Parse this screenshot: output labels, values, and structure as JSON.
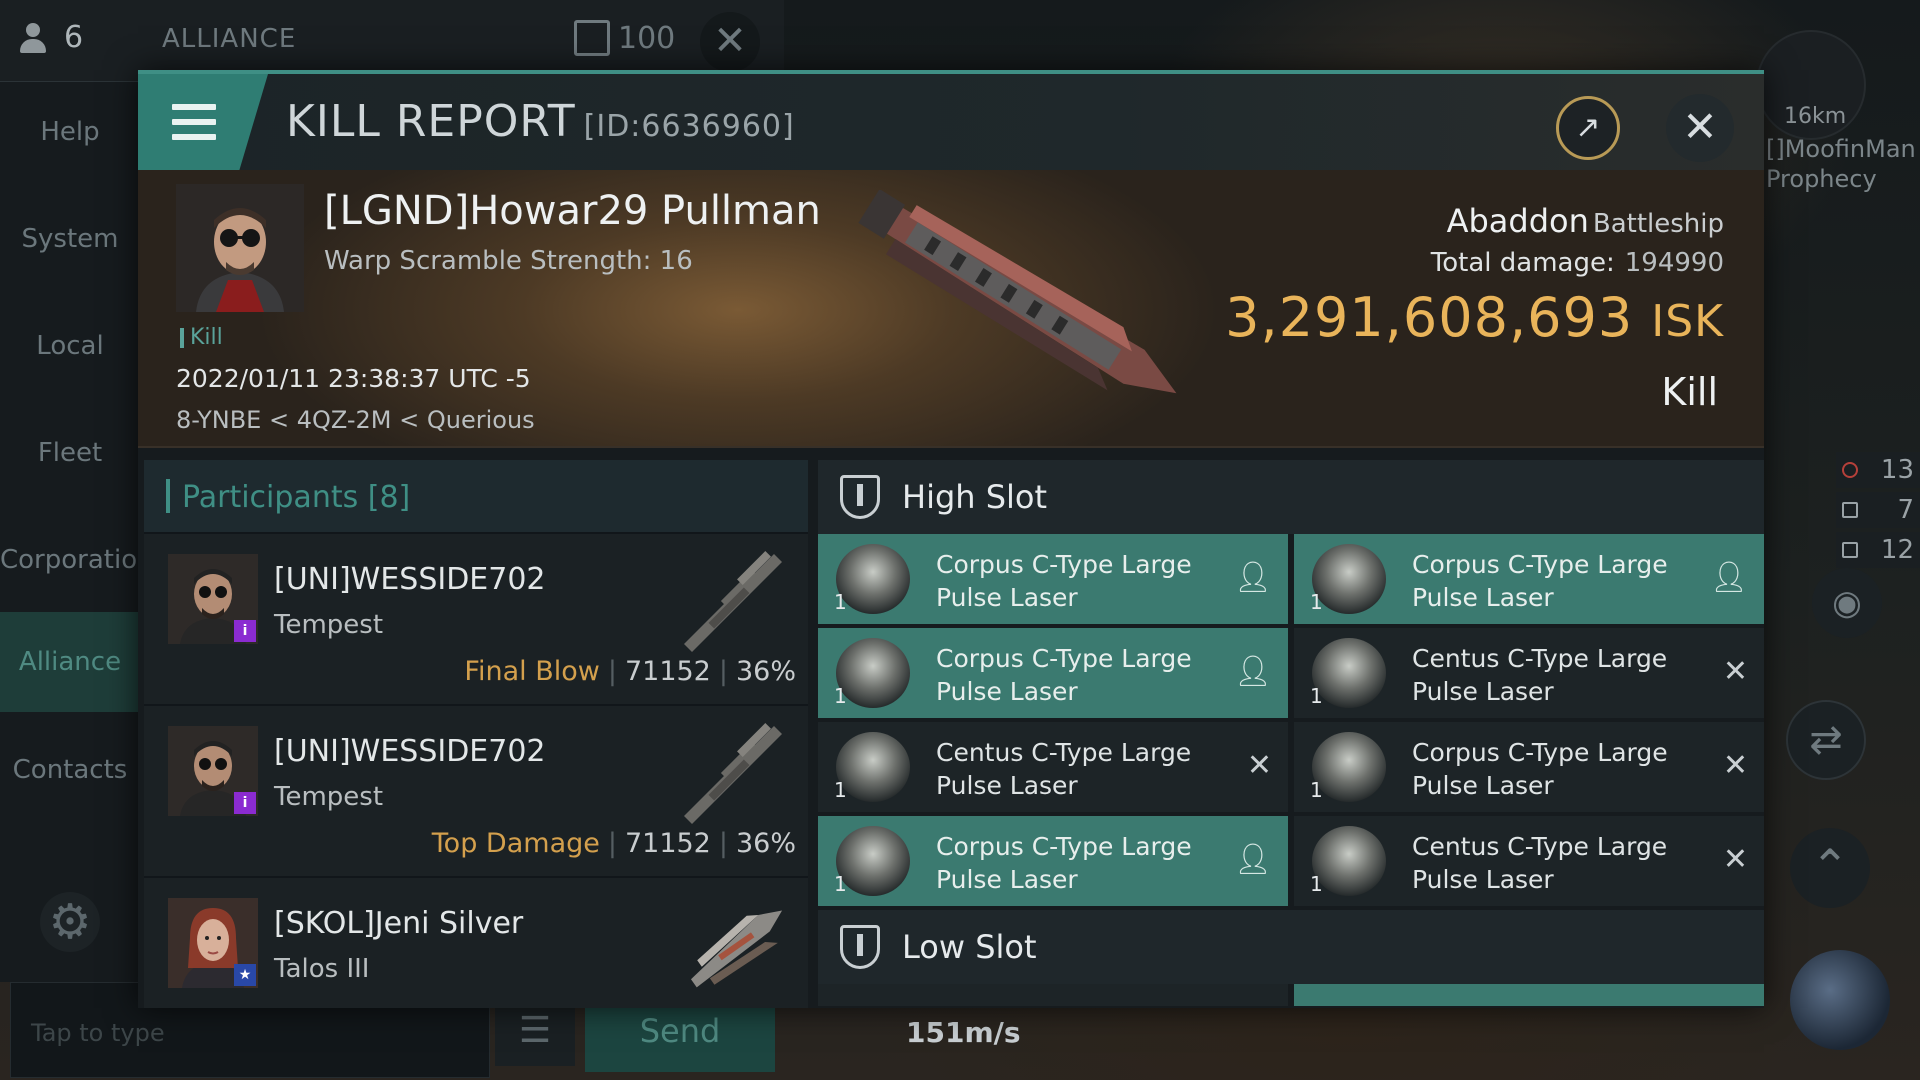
{
  "chat": {
    "member_count": "6",
    "channel_title": "ALLIANCE",
    "channel_count": "100",
    "nav": [
      "Help",
      "System",
      "Local",
      "Fleet",
      "Corporation",
      "Alliance",
      "Contacts"
    ],
    "active_nav": "Alliance",
    "input_placeholder": "Tap to type",
    "send_label": "Send"
  },
  "hud": {
    "target_distance": "16km",
    "target_name": "[]MoofinMan",
    "target_ship": "Prophecy",
    "counters": [
      "13",
      "7",
      "12"
    ],
    "speed": "151m/s",
    "icons": [
      "eye-icon",
      "swap-icon",
      "ascend-icon"
    ]
  },
  "report": {
    "title": "KILL REPORT",
    "id": "[ID:6636960]",
    "victim": {
      "name": "[LGND]Howar29 Pullman",
      "scram": "Warp Scramble Strength: 16",
      "tag": "Kill",
      "time": "2022/01/11 23:38:37 UTC -5",
      "location": "8-YNBE < 4QZ-2M < Querious",
      "ship_name": "Abaddon",
      "ship_class": "Battleship",
      "total_damage_label": "Total damage:",
      "total_damage": "194990",
      "isk_value": "3,291,608,693",
      "isk_unit": "ISK",
      "result": "Kill"
    },
    "participants_title": "Participants [8]",
    "participants": [
      {
        "name": "[UNI]WESSIDE702",
        "ship": "Tempest",
        "role": "Final Blow",
        "damage": "71152",
        "percent": "36%",
        "badge": "i"
      },
      {
        "name": "[UNI]WESSIDE702",
        "ship": "Tempest",
        "role": "Top Damage",
        "damage": "71152",
        "percent": "36%",
        "badge": "i"
      },
      {
        "name": "[SKOL]Jeni Silver",
        "ship": "Talos III",
        "role": "",
        "damage": "",
        "percent": "",
        "badge": "★"
      }
    ],
    "high_slot_title": "High Slot",
    "low_slot_title": "Low Slot",
    "high_slots": [
      {
        "line1": "Corpus C-Type Large",
        "line2": "Pulse Laser",
        "qty": "1",
        "fitted": true
      },
      {
        "line1": "Corpus C-Type Large",
        "line2": "Pulse Laser",
        "qty": "1",
        "fitted": true
      },
      {
        "line1": "Corpus C-Type Large",
        "line2": "Pulse Laser",
        "qty": "1",
        "fitted": true
      },
      {
        "line1": "Centus C-Type Large",
        "line2": "Pulse Laser",
        "qty": "1",
        "fitted": false
      },
      {
        "line1": "Centus C-Type Large",
        "line2": "Pulse Laser",
        "qty": "1",
        "fitted": false
      },
      {
        "line1": "Corpus C-Type Large",
        "line2": "Pulse Laser",
        "qty": "1",
        "fitted": false
      },
      {
        "line1": "Corpus C-Type Large",
        "line2": "Pulse Laser",
        "qty": "1",
        "fitted": true
      },
      {
        "line1": "Centus C-Type Large",
        "line2": "Pulse Laser",
        "qty": "1",
        "fitted": false
      }
    ],
    "status_icons": {
      "fitted": "person-icon",
      "destroyed": "cross-icon"
    }
  }
}
